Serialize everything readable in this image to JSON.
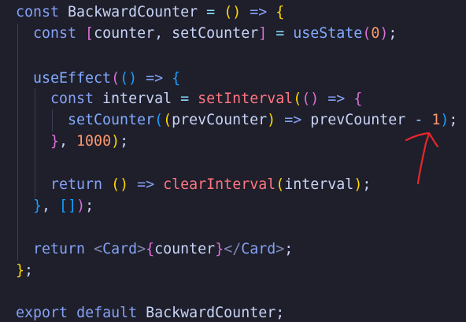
{
  "code": {
    "l1": {
      "kw": "const",
      "name": "BackwardCounter",
      "eq": "=",
      "paren_open": "(",
      "paren_close": ")",
      "arrow": "=>",
      "brace": "{"
    },
    "l2": {
      "kw": "const",
      "lb": "[",
      "a": "counter",
      "comma": ",",
      "b": "setCounter",
      "rb": "]",
      "eq": "=",
      "fn": "useState",
      "po": "(",
      "num": "0",
      "pc": ")",
      "semi": ";"
    },
    "l4": {
      "fn": "useEffect",
      "po": "(",
      "p2o": "(",
      "p2c": ")",
      "arrow": "=>",
      "brace": "{"
    },
    "l5": {
      "kw": "const",
      "name": "interval",
      "eq": "=",
      "fn": "setInterval",
      "po": "(",
      "p2o": "(",
      "p2c": ")",
      "arrow": "=>",
      "brace": "{"
    },
    "l6": {
      "fn": "setCounter",
      "po": "(",
      "p2o": "(",
      "arg": "prevCounter",
      "p2c": ")",
      "arrow": "=>",
      "body": "prevCounter",
      "minus": "-",
      "num": "1",
      "pc": ")",
      "semi": ";"
    },
    "l7": {
      "brace": "}",
      "comma": ",",
      "num": "1000",
      "pc": ")",
      "semi": ";"
    },
    "l9": {
      "kw": "return",
      "po": "(",
      "pc": ")",
      "arrow": "=>",
      "fn": "clearInterval",
      "p2o": "(",
      "arg": "interval",
      "p2c": ")",
      "semi": ";"
    },
    "l10": {
      "brace": "}",
      "comma": ",",
      "lb": "[",
      "rb": "]",
      "pc": ")",
      "semi": ";"
    },
    "l12": {
      "kw": "return",
      "lt1": "<",
      "tag1": "Card",
      "gt1": ">",
      "bo": "{",
      "expr": "counter",
      "bc": "}",
      "lt2": "</",
      "tag2": "Card",
      "gt2": ">",
      "semi": ";"
    },
    "l13": {
      "brace": "}",
      "semi": ";"
    },
    "l15": {
      "kw1": "export",
      "kw2": "default",
      "name": "BackwardCounter",
      "semi": ";"
    }
  },
  "colors": {
    "background": "#1e1f2b",
    "annotation_arrow": "#e8262c"
  }
}
